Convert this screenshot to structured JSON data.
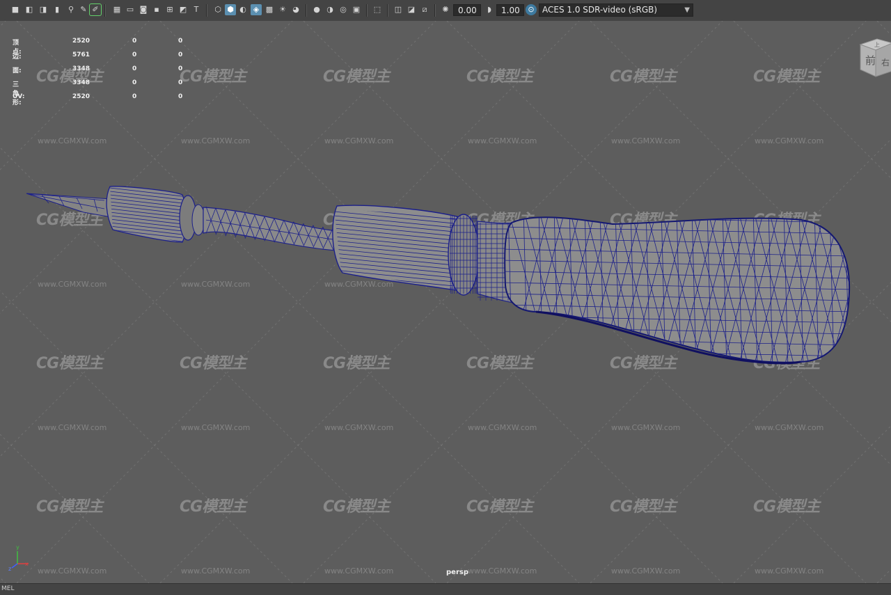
{
  "toolbar": {
    "exposure_value": "0.00",
    "gamma_value": "1.00",
    "color_space": "ACES 1.0 SDR-video (sRGB)",
    "icons": [
      "camera-icon",
      "camera-attributes-icon",
      "bookmark-icon",
      "image-plane-icon",
      "pivot-icon",
      "pencil-icon",
      "grid-icon",
      "film-gate-icon",
      "resolution-gate-icon",
      "gate-mask-icon",
      "field-chart-icon",
      "safe-action-icon",
      "safe-title-icon",
      "wireframe-icon",
      "smooth-shade-icon",
      "wireframe-on-shaded-icon",
      "default-material-icon",
      "textured-icon",
      "use-lights-icon",
      "shadows-icon",
      "ambient-occlusion-icon",
      "motion-blur-icon",
      "antialiasing-icon",
      "depth-of-field-icon",
      "isolate-select-icon",
      "xray-icon",
      "xray-joints-icon",
      "xray-components-icon",
      "exposure-icon",
      "gamma-icon",
      "colorspace-icon"
    ]
  },
  "hud": {
    "rows": [
      {
        "label": "顶点:",
        "v1": "2520",
        "v2": "0",
        "v3": "0"
      },
      {
        "label": "边:",
        "v1": "5761",
        "v2": "0",
        "v3": "0"
      },
      {
        "label": "面:",
        "v1": "3348",
        "v2": "0",
        "v3": "0"
      },
      {
        "label": "三角形:",
        "v1": "3348",
        "v2": "0",
        "v3": "0"
      },
      {
        "label": "UV:",
        "v1": "2520",
        "v2": "0",
        "v3": "0"
      }
    ]
  },
  "viewport": {
    "camera": "persp",
    "background": "#5d5d5d",
    "wire_color": "#1b1f8a",
    "mesh_color": "#8a8a8a"
  },
  "viewcube": {
    "face_front": "前",
    "face_right": "右",
    "face_top": "上"
  },
  "watermark": {
    "logo": "CG模型主",
    "url": "www.CGMXW.com"
  },
  "axis": {
    "x": "x",
    "y": "y",
    "z": "z"
  },
  "bottom_bar": {
    "text": "MEL"
  }
}
